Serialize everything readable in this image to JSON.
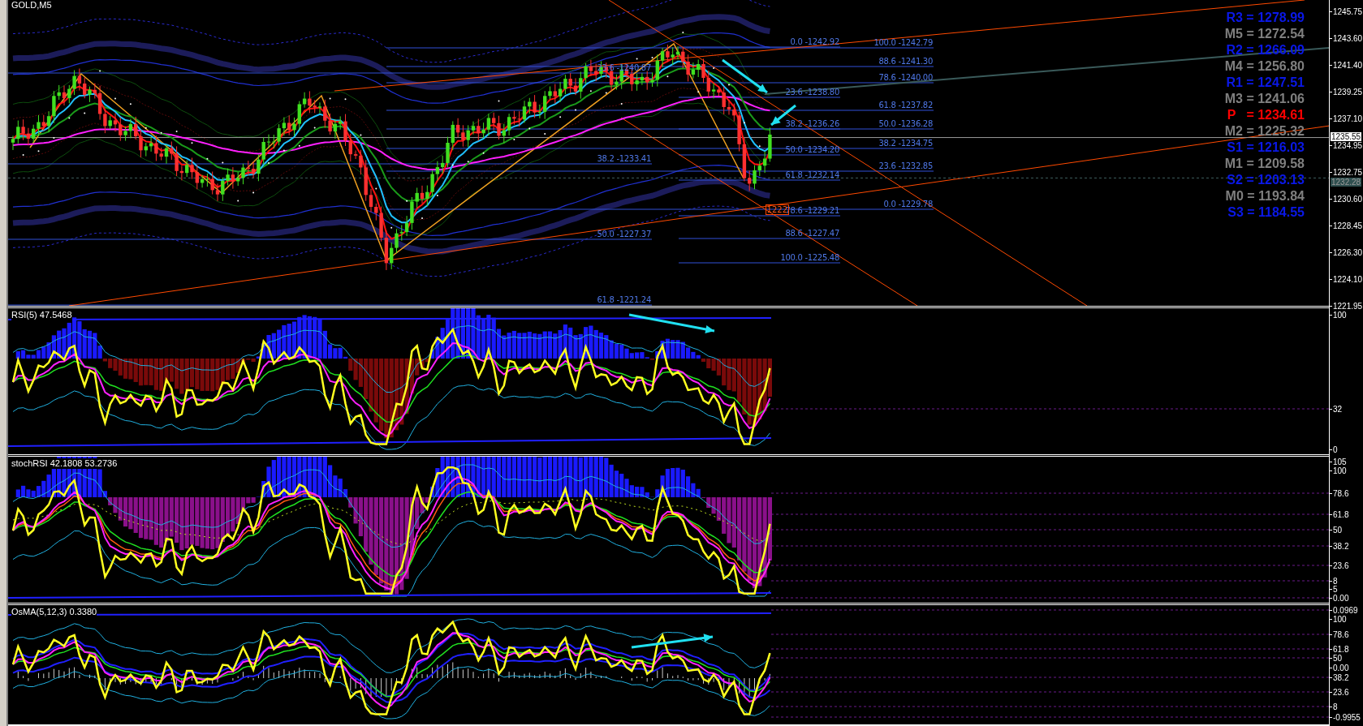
{
  "main_chart": {
    "title": "GOLD,M5",
    "pivot_levels": [
      {
        "text": "R3 = 1278.99",
        "color": "#0a18e8"
      },
      {
        "text": "M5 = 1272.54",
        "color": "#7f7f7f"
      },
      {
        "text": "R2 = 1266.09",
        "color": "#0a18e8"
      },
      {
        "text": "M4 = 1256.80",
        "color": "#7f7f7f"
      },
      {
        "text": "R1 = 1247.51",
        "color": "#0a18e8"
      },
      {
        "text": "M3 = 1241.06",
        "color": "#7f7f7f"
      },
      {
        "text": "P   = 1234.61",
        "color": "#ff0000"
      },
      {
        "text": "M2 = 1225.32",
        "color": "#7f7f7f"
      },
      {
        "text": "S1 = 1216.03",
        "color": "#0a18e8"
      },
      {
        "text": "M1 = 1209.58",
        "color": "#7f7f7f"
      },
      {
        "text": "S2 = 1203.13",
        "color": "#0a18e8"
      },
      {
        "text": "M0 = 1193.84",
        "color": "#7f7f7f"
      },
      {
        "text": "S3 = 1184.55",
        "color": "#0a18e8"
      }
    ],
    "fibonacci_sets": [
      {
        "labels": [
          "23.6 -1240.87",
          "38.2 -1233.41",
          "50.0 -1227.37",
          "61.8 -1221.24"
        ]
      },
      {
        "labels": [
          "0.0 -1242.92",
          "23.6 -1238.80",
          "38.2 -1236.26",
          "50.0 -1234.20",
          "61.8 -1232.14",
          "78.6 -1229.21",
          "88.6 -1227.47",
          "100.0 -1225.48"
        ]
      },
      {
        "labels": [
          "100.0 -1242.79",
          "88.6 -1241.30",
          "78.6 -1240.00",
          "61.8 -1237.82",
          "50.0 -1236.28",
          "38.2 -1234.75",
          "23.6 -1232.85",
          "0.0 -1229.78"
        ]
      }
    ],
    "boxed_label": "1222",
    "price_axis": {
      "ticks": [
        "1245.75",
        "1243.60",
        "1241.40",
        "1239.25",
        "1237.10",
        "1234.95",
        "1232.75",
        "1230.60",
        "1228.45",
        "1226.30",
        "1224.10",
        "1221.95"
      ],
      "price_tags": [
        {
          "text": "1235.55",
          "kind": "bid"
        },
        {
          "text": "1232.28",
          "kind": "line"
        }
      ]
    }
  },
  "indicators": [
    {
      "kind": "rsi",
      "title": "RSI(5) 47.5468",
      "axis_labels": [
        "100",
        "32",
        "0"
      ]
    },
    {
      "kind": "stoch",
      "title": "stochRSI 42.1808 53.2736",
      "axis_labels": [
        "105",
        "100",
        "78.6",
        "61.8",
        "50",
        "38.2",
        "23.6",
        "8",
        "5",
        "0.00"
      ]
    },
    {
      "kind": "osma",
      "title": "OsMA(5,12,3) 0.3380",
      "axis_labels": [
        "0.0969",
        "100",
        "78.6",
        "61.8",
        "50",
        "0.00",
        "38.2",
        "23.6",
        "8",
        "-0.9955"
      ]
    }
  ]
}
